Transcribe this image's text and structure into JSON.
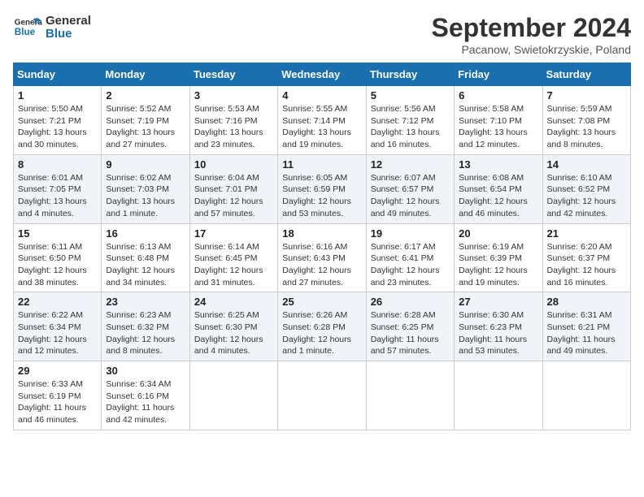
{
  "header": {
    "logo_line1": "General",
    "logo_line2": "Blue",
    "month": "September 2024",
    "location": "Pacanow, Swietokrzyskie, Poland"
  },
  "weekdays": [
    "Sunday",
    "Monday",
    "Tuesday",
    "Wednesday",
    "Thursday",
    "Friday",
    "Saturday"
  ],
  "weeks": [
    [
      {
        "day": "1",
        "info": "Sunrise: 5:50 AM\nSunset: 7:21 PM\nDaylight: 13 hours\nand 30 minutes."
      },
      {
        "day": "2",
        "info": "Sunrise: 5:52 AM\nSunset: 7:19 PM\nDaylight: 13 hours\nand 27 minutes."
      },
      {
        "day": "3",
        "info": "Sunrise: 5:53 AM\nSunset: 7:16 PM\nDaylight: 13 hours\nand 23 minutes."
      },
      {
        "day": "4",
        "info": "Sunrise: 5:55 AM\nSunset: 7:14 PM\nDaylight: 13 hours\nand 19 minutes."
      },
      {
        "day": "5",
        "info": "Sunrise: 5:56 AM\nSunset: 7:12 PM\nDaylight: 13 hours\nand 16 minutes."
      },
      {
        "day": "6",
        "info": "Sunrise: 5:58 AM\nSunset: 7:10 PM\nDaylight: 13 hours\nand 12 minutes."
      },
      {
        "day": "7",
        "info": "Sunrise: 5:59 AM\nSunset: 7:08 PM\nDaylight: 13 hours\nand 8 minutes."
      }
    ],
    [
      {
        "day": "8",
        "info": "Sunrise: 6:01 AM\nSunset: 7:05 PM\nDaylight: 13 hours\nand 4 minutes."
      },
      {
        "day": "9",
        "info": "Sunrise: 6:02 AM\nSunset: 7:03 PM\nDaylight: 13 hours\nand 1 minute."
      },
      {
        "day": "10",
        "info": "Sunrise: 6:04 AM\nSunset: 7:01 PM\nDaylight: 12 hours\nand 57 minutes."
      },
      {
        "day": "11",
        "info": "Sunrise: 6:05 AM\nSunset: 6:59 PM\nDaylight: 12 hours\nand 53 minutes."
      },
      {
        "day": "12",
        "info": "Sunrise: 6:07 AM\nSunset: 6:57 PM\nDaylight: 12 hours\nand 49 minutes."
      },
      {
        "day": "13",
        "info": "Sunrise: 6:08 AM\nSunset: 6:54 PM\nDaylight: 12 hours\nand 46 minutes."
      },
      {
        "day": "14",
        "info": "Sunrise: 6:10 AM\nSunset: 6:52 PM\nDaylight: 12 hours\nand 42 minutes."
      }
    ],
    [
      {
        "day": "15",
        "info": "Sunrise: 6:11 AM\nSunset: 6:50 PM\nDaylight: 12 hours\nand 38 minutes."
      },
      {
        "day": "16",
        "info": "Sunrise: 6:13 AM\nSunset: 6:48 PM\nDaylight: 12 hours\nand 34 minutes."
      },
      {
        "day": "17",
        "info": "Sunrise: 6:14 AM\nSunset: 6:45 PM\nDaylight: 12 hours\nand 31 minutes."
      },
      {
        "day": "18",
        "info": "Sunrise: 6:16 AM\nSunset: 6:43 PM\nDaylight: 12 hours\nand 27 minutes."
      },
      {
        "day": "19",
        "info": "Sunrise: 6:17 AM\nSunset: 6:41 PM\nDaylight: 12 hours\nand 23 minutes."
      },
      {
        "day": "20",
        "info": "Sunrise: 6:19 AM\nSunset: 6:39 PM\nDaylight: 12 hours\nand 19 minutes."
      },
      {
        "day": "21",
        "info": "Sunrise: 6:20 AM\nSunset: 6:37 PM\nDaylight: 12 hours\nand 16 minutes."
      }
    ],
    [
      {
        "day": "22",
        "info": "Sunrise: 6:22 AM\nSunset: 6:34 PM\nDaylight: 12 hours\nand 12 minutes."
      },
      {
        "day": "23",
        "info": "Sunrise: 6:23 AM\nSunset: 6:32 PM\nDaylight: 12 hours\nand 8 minutes."
      },
      {
        "day": "24",
        "info": "Sunrise: 6:25 AM\nSunset: 6:30 PM\nDaylight: 12 hours\nand 4 minutes."
      },
      {
        "day": "25",
        "info": "Sunrise: 6:26 AM\nSunset: 6:28 PM\nDaylight: 12 hours\nand 1 minute."
      },
      {
        "day": "26",
        "info": "Sunrise: 6:28 AM\nSunset: 6:25 PM\nDaylight: 11 hours\nand 57 minutes."
      },
      {
        "day": "27",
        "info": "Sunrise: 6:30 AM\nSunset: 6:23 PM\nDaylight: 11 hours\nand 53 minutes."
      },
      {
        "day": "28",
        "info": "Sunrise: 6:31 AM\nSunset: 6:21 PM\nDaylight: 11 hours\nand 49 minutes."
      }
    ],
    [
      {
        "day": "29",
        "info": "Sunrise: 6:33 AM\nSunset: 6:19 PM\nDaylight: 11 hours\nand 46 minutes."
      },
      {
        "day": "30",
        "info": "Sunrise: 6:34 AM\nSunset: 6:16 PM\nDaylight: 11 hours\nand 42 minutes."
      },
      {
        "day": "",
        "info": ""
      },
      {
        "day": "",
        "info": ""
      },
      {
        "day": "",
        "info": ""
      },
      {
        "day": "",
        "info": ""
      },
      {
        "day": "",
        "info": ""
      }
    ]
  ]
}
